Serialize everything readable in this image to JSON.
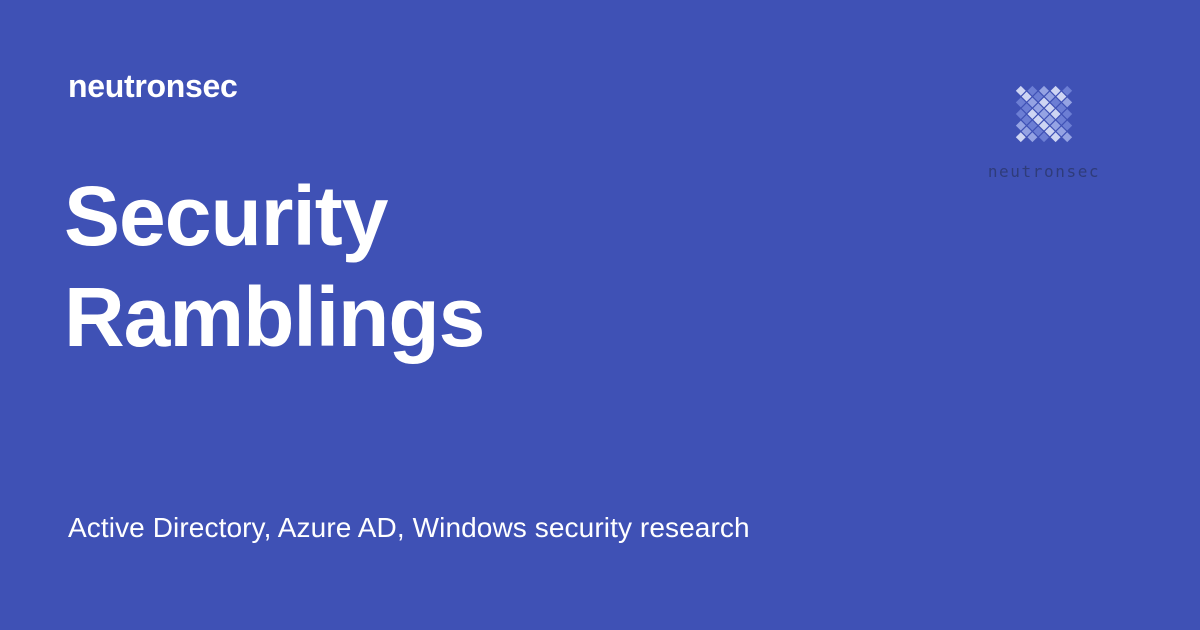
{
  "site": {
    "name": "neutronsec"
  },
  "hero": {
    "title_line1": "Security",
    "title_line2": "Ramblings",
    "description": "Active Directory, Azure AD, Windows security research"
  },
  "logo": {
    "icon": "diamond-mosaic-logo-icon",
    "wordmark": "neutronsec"
  },
  "colors": {
    "background": "#3f51b5",
    "text": "#ffffff",
    "logo_light": "#d6dcf7",
    "logo_mid": "#9aa8e6",
    "logo_dark": "#6f81d6"
  }
}
